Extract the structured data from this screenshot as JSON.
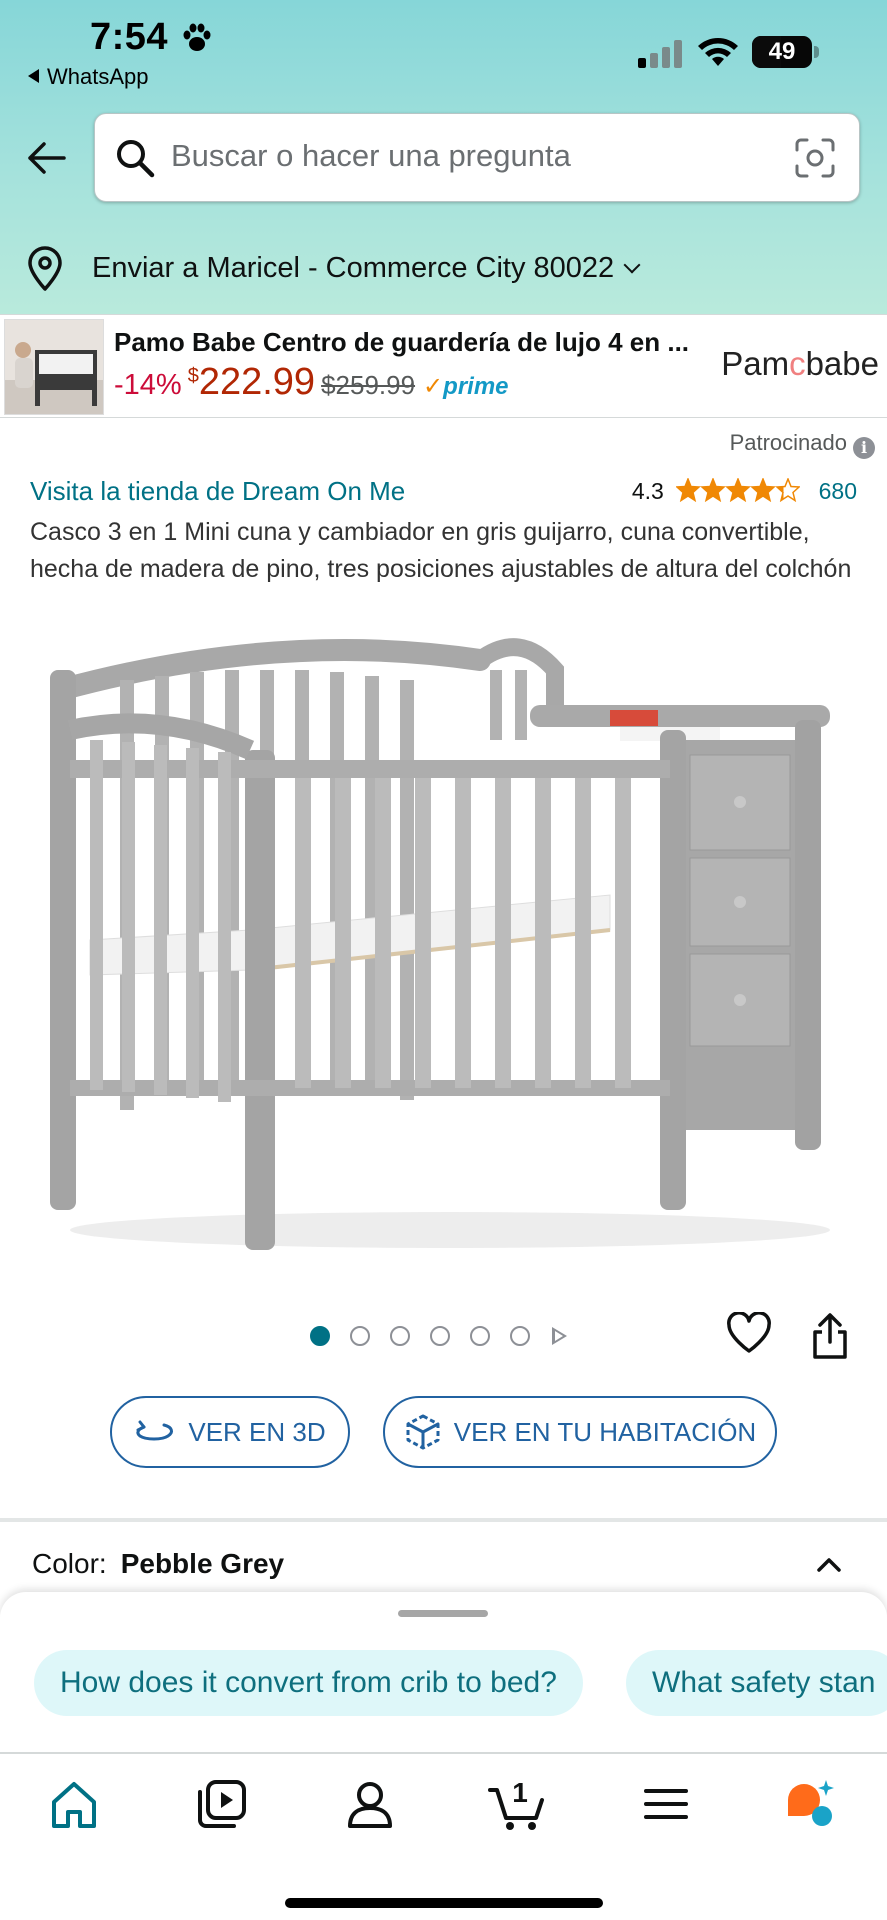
{
  "status_bar": {
    "time": "7:54",
    "back_app": "WhatsApp",
    "battery": "49",
    "battery_fraction": 0.49
  },
  "search": {
    "placeholder": "Buscar o hacer una pregunta"
  },
  "delivery": {
    "text": "Enviar a Maricel - Commerce City 80022"
  },
  "ad": {
    "title": "Pamo Babe Centro de guardería de lujo 4 en ...",
    "discount": "-14%",
    "currency": "$",
    "price": "222.99",
    "list_price": "$259.99",
    "prime": "prime",
    "brand_left": "Pam",
    "brand_mid": "c",
    "brand_right": "babe"
  },
  "sponsored": {
    "label": "Patrocinado",
    "info": "i"
  },
  "product": {
    "store_link": "Visita la tienda de Dream On Me",
    "rating": "4.3",
    "rating_value": 4.3,
    "review_count": "680",
    "title": "Casco 3 en 1 Mini cuna y cambiador en gris guijarro, cuna convertible, hecha de madera de pino, tres posiciones ajustables de altura del colchón"
  },
  "gallery": {
    "image_count": 6,
    "active_index": 0
  },
  "buttons": {
    "view_3d": "VER EN 3D",
    "view_room": "VER EN TU HABITACIÓN"
  },
  "color": {
    "label": "Color:",
    "value": "Pebble Grey"
  },
  "suggestions": [
    "How does it convert from crib to bed?",
    "What safety stan"
  ],
  "cart": {
    "count": "1"
  },
  "colors": {
    "link": "#007185",
    "price": "#b12704",
    "discount": "#cc0c39",
    "button": "#2162a1",
    "star": "#f08804",
    "chip_bg": "#def7f9"
  }
}
